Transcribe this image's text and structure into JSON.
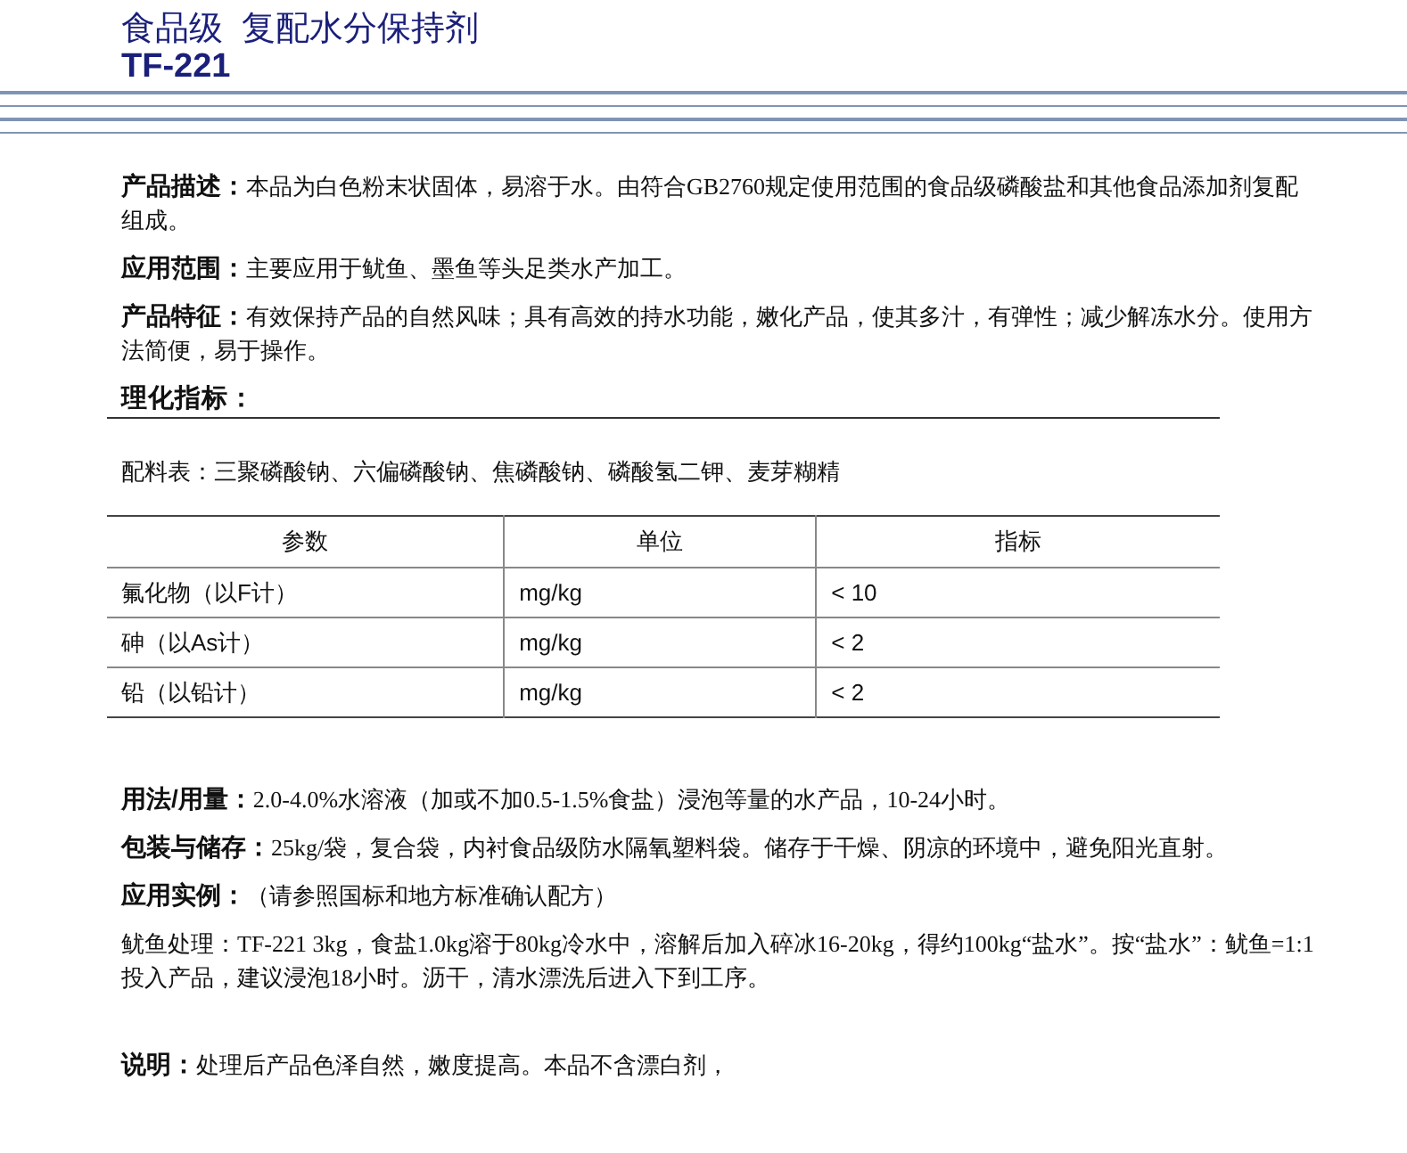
{
  "header": {
    "title": "食品级  复配水分保持剂",
    "model": "TF-221"
  },
  "intro": [
    {
      "text": "**产品描述：**本品为白色粉末状固体，易溶于水。由符合GB2760规定使用范围的食品级磷酸盐和其他食品添加剂复配组成。"
    },
    {
      "text": "**应用范围：**主要应用于鱿鱼、墨鱼等头足类水产加工。"
    },
    {
      "text": "**产品特征：**有效保持产品的自然风味；具有高效的持水功能，嫩化产品，使其多汁，有弹性；减少解冻水分。使用方法简便，易于操作。"
    }
  ],
  "spec_heading": "理化指标：",
  "ingredients": "配料表：三聚磷酸钠、六偏磷酸钠、焦磷酸钠、磷酸氢二钾、麦芽糊精",
  "table": {
    "columns": [
      "参数",
      "单位",
      "指标"
    ],
    "rows": [
      [
        "氟化物（以F计）",
        "mg/kg",
        "< 10"
      ],
      [
        "砷（以As计）",
        "mg/kg",
        "< 2"
      ],
      [
        "铅（以铅计）",
        "mg/kg",
        "< 2"
      ]
    ]
  },
  "usage": [
    {
      "text": "**用法/用量：**2.0-4.0%水溶液（加或不加0.5-1.5%食盐）浸泡等量的水产品，10-24小时。"
    },
    {
      "text": "**包装与储存：**25kg/袋，复合袋，内衬食品级防水隔氧塑料袋。储存于干燥、阴凉的环境中，避免阳光直射。"
    },
    {
      "text": "**应用实例：**（请参照国标和地方标准确认配方）"
    },
    {
      "text": "鱿鱼处理：TF-221 3kg，食盐1.0kg溶于80kg冷水中，溶解后加入碎冰16-20kg，得约100kg“盐水”。按“盐水”：鱿鱼=1:1投入产品，建议浸泡18小时。沥干，清水漂洗后进入下到工序。"
    }
  ],
  "note": {
    "text": "**说明：**处理后产品色泽自然，嫩度提高。本品不含漂白剂，"
  }
}
